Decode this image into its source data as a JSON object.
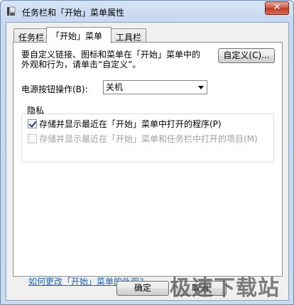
{
  "window": {
    "title": "任务栏和「开始」菜单属性"
  },
  "title_buttons": {
    "close": "✕"
  },
  "tabs": [
    {
      "label": "任务栏"
    },
    {
      "label": "「开始」菜单"
    },
    {
      "label": "工具栏"
    }
  ],
  "start_menu": {
    "description_line1": "要自定义链接、图标和菜单在「开始」菜单中的",
    "description_line2": "外观和行为，请单击“自定义”。",
    "customize_button": "自定义(C)...",
    "power_label": "电源按钮操作(B):",
    "power_value": "关机",
    "privacy_title": "隐私",
    "privacy_option1": "存储并显示最近在「开始」菜单中打开的程序(P)",
    "privacy_option1_checked": true,
    "privacy_option2": "存储并显示最近在「开始」菜单和任务栏中打开的项目(M)",
    "privacy_option2_checked": false,
    "help_link": "如何更改「开始」菜单的外观?"
  },
  "dialog_buttons": {
    "ok": "确定",
    "cancel": "取消"
  },
  "watermark": "极速下载站"
}
